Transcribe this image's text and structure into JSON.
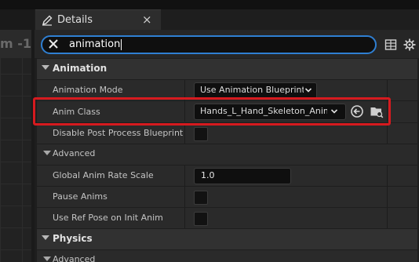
{
  "left_pane": {
    "fragment_text": "m -1"
  },
  "tab": {
    "title": "Details",
    "close_glyph": "×",
    "icon": "pencil-icon"
  },
  "search": {
    "value": "animation",
    "clear_icon": "close-icon"
  },
  "toolbar": {
    "table_icon": "table-view-icon",
    "settings_icon": "gear-icon"
  },
  "categories": {
    "animation": {
      "label": "Animation"
    },
    "physics": {
      "label": "Physics"
    }
  },
  "properties": {
    "animation_mode": {
      "label": "Animation Mode",
      "value": "Use Animation Blueprint"
    },
    "anim_class": {
      "label": "Anim Class",
      "value": "Hands_L_Hand_Skeleton_AnimBP"
    },
    "disable_post_process": {
      "label": "Disable Post Process Blueprint"
    },
    "advanced_1": {
      "label": "Advanced"
    },
    "global_anim_rate": {
      "label": "Global Anim Rate Scale",
      "value": "1.0"
    },
    "pause_anims": {
      "label": "Pause Anims"
    },
    "use_ref_pose": {
      "label": "Use Ref Pose on Init Anim"
    },
    "advanced_2": {
      "label": "Advanced"
    }
  },
  "colors": {
    "accent_blue": "#2f7fd2",
    "highlight_red": "#d61a1f"
  }
}
